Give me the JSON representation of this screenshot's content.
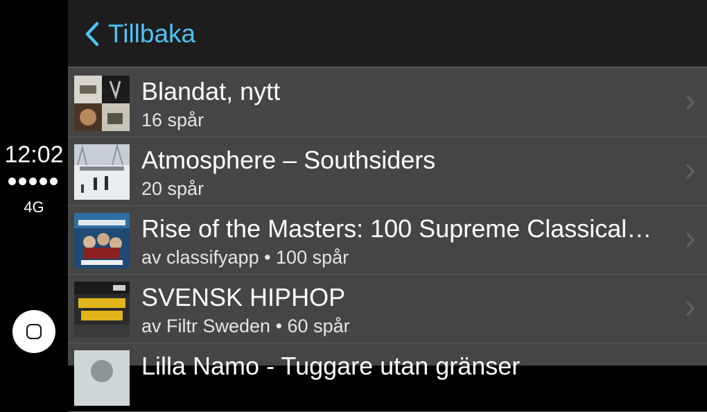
{
  "status": {
    "time": "12:02",
    "network": "4G",
    "signal_bars": 5
  },
  "nav": {
    "back_label": "Tillbaka",
    "accent_color": "#4fc3f7"
  },
  "playlists": [
    {
      "title": "Blandat, nytt",
      "subtitle": "16 spår"
    },
    {
      "title": "Atmosphere – Southsiders",
      "subtitle": "20 spår"
    },
    {
      "title": "Rise of the Masters: 100 Supreme Classical…",
      "subtitle": "av classifyapp • 100 spår"
    },
    {
      "title": "SVENSK HIPHOP",
      "subtitle": "av Filtr Sweden • 60 spår"
    },
    {
      "title": "Lilla Namo - Tuggare utan gränser",
      "subtitle": ""
    }
  ],
  "icons": {
    "back": "chevron-left-icon",
    "row_disclosure": "chevron-right-icon",
    "home": "home-button-icon"
  }
}
